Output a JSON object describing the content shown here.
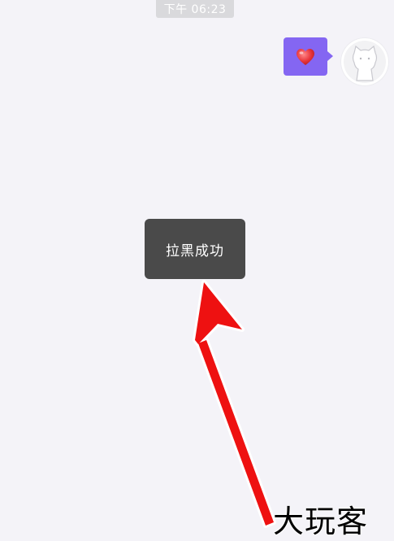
{
  "chat": {
    "timestamp": "下午 06:23",
    "message": {
      "icon": "heart-emoji-icon",
      "bubble_color": "#8466f2"
    },
    "avatar_icon": "cat-avatar-icon"
  },
  "toast": {
    "text": "拉黑成功"
  },
  "annotation": {
    "arrow_color": "#ee1111",
    "watermark": "大玩客"
  }
}
